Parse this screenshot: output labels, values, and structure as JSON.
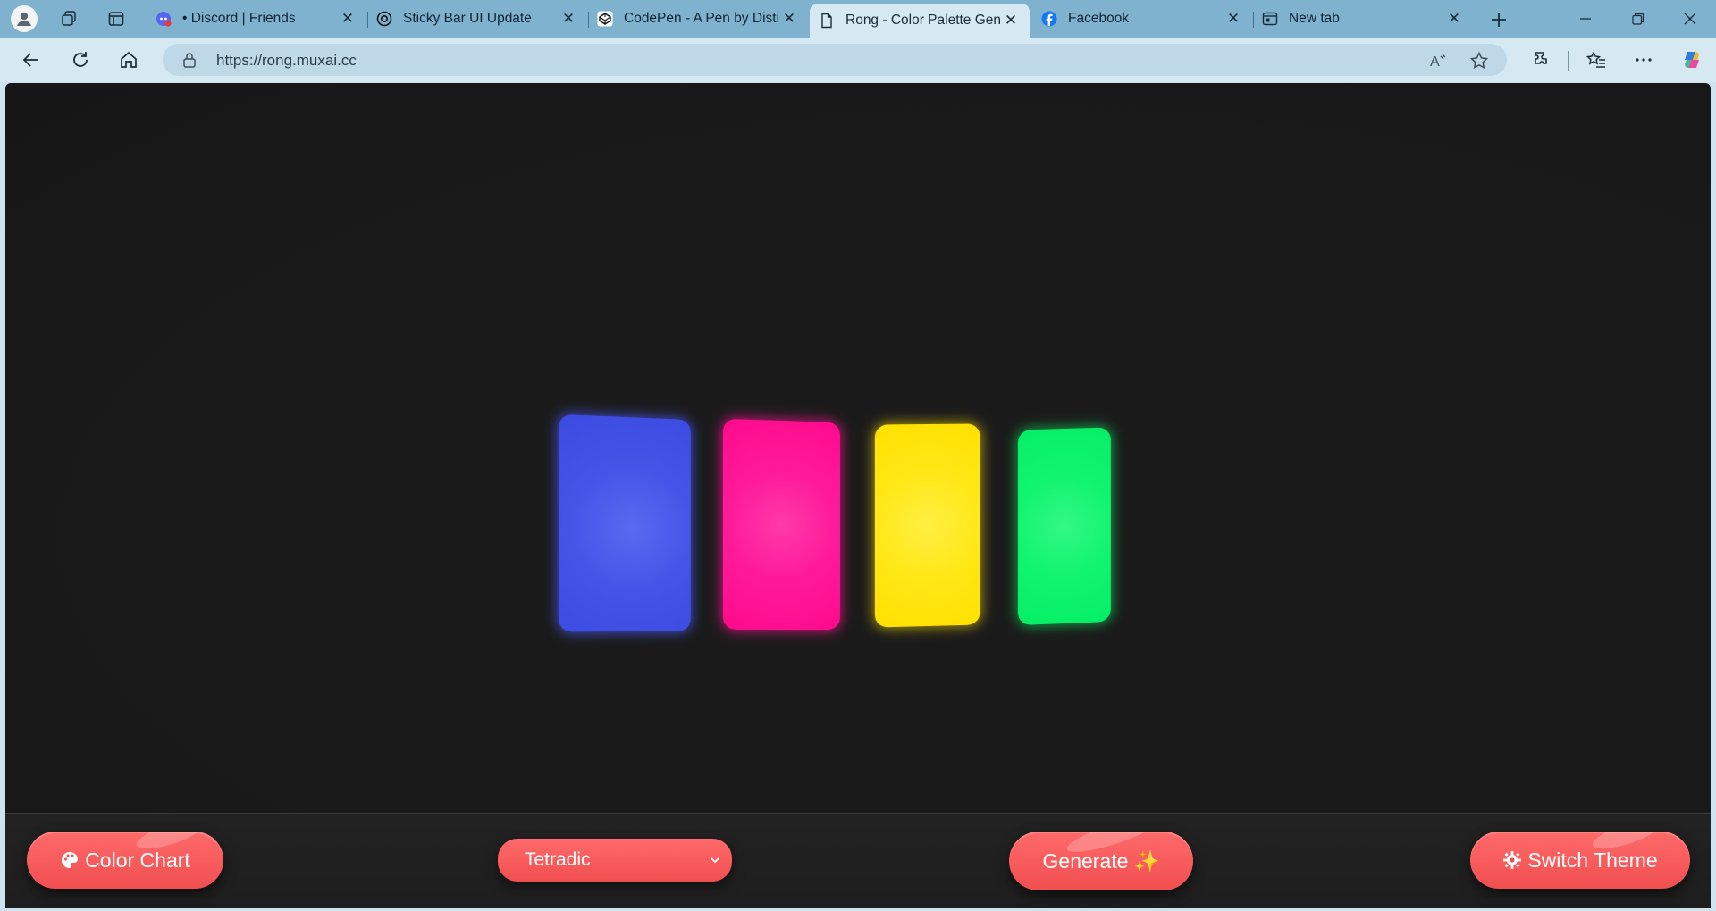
{
  "browser": {
    "tabs": [
      {
        "title": "• Discord | Friends",
        "favicon": "discord-icon",
        "active": false
      },
      {
        "title": "Sticky Bar UI Update",
        "favicon": "openai-icon",
        "active": false
      },
      {
        "title": "CodePen - A Pen by Distil",
        "favicon": "codepen-icon",
        "active": false
      },
      {
        "title": "Rong - Color Palette Gene",
        "favicon": "document-icon",
        "active": true
      },
      {
        "title": "Facebook",
        "favicon": "facebook-icon",
        "active": false
      },
      {
        "title": "New tab",
        "favicon": "newtab-icon",
        "active": false
      }
    ],
    "address_bar": {
      "url": "https://rong.muxai.cc"
    }
  },
  "app": {
    "palette": {
      "colors": [
        "#4555e8",
        "#ff0a8c",
        "#ffe818",
        "#12f470"
      ]
    },
    "controls": {
      "color_chart_label": "Color Chart",
      "scheme_selected": "Tetradic",
      "generate_label": "Generate ✨",
      "switch_theme_label": "Switch Theme"
    },
    "accent_color": "#f35555"
  }
}
